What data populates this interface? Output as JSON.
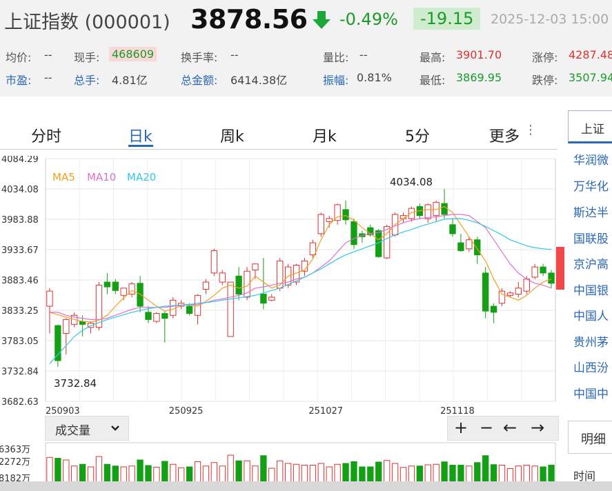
{
  "header": {
    "index_name": "上证指数 (000001)",
    "price": "3878.56",
    "change_pct": "-0.49%",
    "change": "-19.15",
    "datetime": "2025-12-03 15:00",
    "direction_icon": "down-arrow-icon"
  },
  "stats": {
    "row1": [
      {
        "label": "均价:",
        "value": "--"
      },
      {
        "label": "现手:",
        "value": "468609"
      },
      {
        "label": "换手率:",
        "value": "--"
      },
      {
        "label": "量比:",
        "value": "--"
      },
      {
        "label": "最高:",
        "value": "3901.70"
      },
      {
        "label": "涨停:",
        "value": "4287.48"
      }
    ],
    "row2": [
      {
        "label": "市盈:",
        "value": "--"
      },
      {
        "label": "总手:",
        "value": "4.81亿"
      },
      {
        "label": "总金额:",
        "value": "6414.38亿"
      },
      {
        "label": "振幅:",
        "value": "0.81%"
      },
      {
        "label": "最低:",
        "value": "3869.95"
      },
      {
        "label": "跌停:",
        "value": "3507.94"
      }
    ]
  },
  "tabs": [
    "分时",
    "日k",
    "周k",
    "月k",
    "5分",
    "更多"
  ],
  "active_tab": "日k",
  "more_icon": "vertical-dots-icon",
  "legend": {
    "ma5": "MA5",
    "ma10": "MA10",
    "ma20": "MA20"
  },
  "colors": {
    "up": "#e03030",
    "down": "#14a014",
    "ma5": "#f0a020",
    "ma10": "#e070d0",
    "ma20": "#30c8e8",
    "accent": "#2a67b5"
  },
  "annotations": {
    "high_label": "4034.08",
    "low_label": "3732.84"
  },
  "volume": {
    "selector_label": "成交量",
    "axis_labels": [
      "6363万",
      "2272万",
      "8182万"
    ],
    "toolbar": [
      "+",
      "−",
      "←",
      "→"
    ]
  },
  "sidebar": {
    "header": "上证",
    "items": [
      "华润微",
      "万华化",
      "斯达半",
      "国联股",
      "京沪高",
      "中国银",
      "中国人",
      "贵州茅",
      "山西汾",
      "中国中"
    ],
    "detail_tab": "明细",
    "time_label": "时间"
  },
  "chart_data": {
    "type": "candlestick",
    "y_ticks": [
      "4084.29",
      "4034.08",
      "3983.88",
      "3933.67",
      "3883.46",
      "3833.25",
      "3783.05",
      "3732.84",
      "3682.63"
    ],
    "ylim": [
      3682.63,
      4084.29
    ],
    "x_ticks": [
      {
        "label": "250903",
        "index": 0
      },
      {
        "label": "250925",
        "index": 15
      },
      {
        "label": "251027",
        "index": 32
      },
      {
        "label": "251118",
        "index": 48
      }
    ],
    "candles": [
      {
        "o": 3840,
        "h": 3870,
        "l": 3795,
        "c": 3865
      },
      {
        "o": 3808,
        "h": 3810,
        "l": 3740,
        "c": 3750
      },
      {
        "o": 3795,
        "h": 3820,
        "l": 3760,
        "c": 3818
      },
      {
        "o": 3810,
        "h": 3830,
        "l": 3805,
        "c": 3825
      },
      {
        "o": 3815,
        "h": 3825,
        "l": 3790,
        "c": 3810
      },
      {
        "o": 3805,
        "h": 3815,
        "l": 3795,
        "c": 3812
      },
      {
        "o": 3805,
        "h": 3880,
        "l": 3800,
        "c": 3875
      },
      {
        "o": 3880,
        "h": 3895,
        "l": 3860,
        "c": 3872
      },
      {
        "o": 3880,
        "h": 3885,
        "l": 3860,
        "c": 3866
      },
      {
        "o": 3858,
        "h": 3870,
        "l": 3850,
        "c": 3870
      },
      {
        "o": 3860,
        "h": 3880,
        "l": 3855,
        "c": 3877
      },
      {
        "o": 3878,
        "h": 3890,
        "l": 3830,
        "c": 3840
      },
      {
        "o": 3830,
        "h": 3840,
        "l": 3812,
        "c": 3818
      },
      {
        "o": 3815,
        "h": 3830,
        "l": 3812,
        "c": 3828
      },
      {
        "o": 3828,
        "h": 3832,
        "l": 3780,
        "c": 3820
      },
      {
        "o": 3825,
        "h": 3855,
        "l": 3820,
        "c": 3850
      },
      {
        "o": 3840,
        "h": 3850,
        "l": 3835,
        "c": 3845
      },
      {
        "o": 3840,
        "h": 3845,
        "l": 3825,
        "c": 3828
      },
      {
        "o": 3825,
        "h": 3860,
        "l": 3810,
        "c": 3858
      },
      {
        "o": 3868,
        "h": 3885,
        "l": 3860,
        "c": 3880
      },
      {
        "o": 3895,
        "h": 3935,
        "l": 3890,
        "c": 3932
      },
      {
        "o": 3880,
        "h": 3900,
        "l": 3875,
        "c": 3895
      },
      {
        "o": 3790,
        "h": 3880,
        "l": 3790,
        "c": 3880
      },
      {
        "o": 3890,
        "h": 3905,
        "l": 3850,
        "c": 3860
      },
      {
        "o": 3855,
        "h": 3905,
        "l": 3850,
        "c": 3898
      },
      {
        "o": 3900,
        "h": 3910,
        "l": 3885,
        "c": 3910
      },
      {
        "o": 3860,
        "h": 3920,
        "l": 3835,
        "c": 3845
      },
      {
        "o": 3850,
        "h": 3860,
        "l": 3848,
        "c": 3855
      },
      {
        "o": 3870,
        "h": 3920,
        "l": 3865,
        "c": 3915
      },
      {
        "o": 3875,
        "h": 3910,
        "l": 3870,
        "c": 3905
      },
      {
        "o": 3880,
        "h": 3910,
        "l": 3875,
        "c": 3908
      },
      {
        "o": 3898,
        "h": 3920,
        "l": 3890,
        "c": 3915
      },
      {
        "o": 3925,
        "h": 3950,
        "l": 3920,
        "c": 3945
      },
      {
        "o": 3960,
        "h": 3995,
        "l": 3955,
        "c": 3992
      },
      {
        "o": 3980,
        "h": 3990,
        "l": 3970,
        "c": 3985
      },
      {
        "o": 3982,
        "h": 4010,
        "l": 3975,
        "c": 4008
      },
      {
        "o": 4000,
        "h": 4015,
        "l": 3975,
        "c": 3983
      },
      {
        "o": 3980,
        "h": 3985,
        "l": 3935,
        "c": 3942
      },
      {
        "o": 3960,
        "h": 3965,
        "l": 3945,
        "c": 3955
      },
      {
        "o": 3970,
        "h": 3975,
        "l": 3955,
        "c": 3958
      },
      {
        "o": 3965,
        "h": 3968,
        "l": 3920,
        "c": 3922
      },
      {
        "o": 3920,
        "h": 3975,
        "l": 3918,
        "c": 3972
      },
      {
        "o": 3958,
        "h": 3995,
        "l": 3955,
        "c": 3992
      },
      {
        "o": 3985,
        "h": 3995,
        "l": 3978,
        "c": 3990
      },
      {
        "o": 3985,
        "h": 4005,
        "l": 3980,
        "c": 4002
      },
      {
        "o": 4005,
        "h": 4010,
        "l": 3985,
        "c": 3990
      },
      {
        "o": 3985,
        "h": 4010,
        "l": 3978,
        "c": 4008
      },
      {
        "o": 3990,
        "h": 4015,
        "l": 3980,
        "c": 4012
      },
      {
        "o": 4010,
        "h": 4034,
        "l": 3985,
        "c": 3992
      },
      {
        "o": 3975,
        "h": 3985,
        "l": 3955,
        "c": 3960
      },
      {
        "o": 3945,
        "h": 3960,
        "l": 3930,
        "c": 3932
      },
      {
        "o": 3935,
        "h": 3955,
        "l": 3930,
        "c": 3950
      },
      {
        "o": 3950,
        "h": 3955,
        "l": 3910,
        "c": 3925
      },
      {
        "o": 3895,
        "h": 3905,
        "l": 3820,
        "c": 3832
      },
      {
        "o": 3840,
        "h": 3845,
        "l": 3812,
        "c": 3830
      },
      {
        "o": 3845,
        "h": 3870,
        "l": 3840,
        "c": 3865
      },
      {
        "o": 3858,
        "h": 3865,
        "l": 3855,
        "c": 3862
      },
      {
        "o": 3860,
        "h": 3880,
        "l": 3855,
        "c": 3870
      },
      {
        "o": 3865,
        "h": 3890,
        "l": 3860,
        "c": 3885
      },
      {
        "o": 3888,
        "h": 3910,
        "l": 3885,
        "c": 3905
      },
      {
        "o": 3905,
        "h": 3910,
        "l": 3890,
        "c": 3895
      },
      {
        "o": 3895,
        "h": 3900,
        "l": 3870,
        "c": 3878
      }
    ],
    "ma5": [
      3830,
      3826,
      3822,
      3818,
      3815,
      3814,
      3817,
      3825,
      3840,
      3854,
      3866,
      3860,
      3850,
      3840,
      3832,
      3835,
      3842,
      3843,
      3840,
      3848,
      3858,
      3870,
      3875,
      3870,
      3873,
      3890,
      3880,
      3870,
      3875,
      3890,
      3895,
      3900,
      3918,
      3950,
      3975,
      3988,
      3990,
      3982,
      3970,
      3960,
      3950,
      3960,
      3975,
      3985,
      3995,
      3998,
      4000,
      4000,
      4005,
      3995,
      3975,
      3955,
      3935,
      3915,
      3885,
      3860,
      3855,
      3850,
      3858,
      3870,
      3880,
      3885
    ],
    "ma10": [
      3830,
      3830,
      3825,
      3822,
      3820,
      3818,
      3818,
      3820,
      3825,
      3830,
      3835,
      3838,
      3838,
      3838,
      3838,
      3840,
      3842,
      3842,
      3843,
      3846,
      3850,
      3852,
      3855,
      3858,
      3862,
      3870,
      3872,
      3875,
      3878,
      3880,
      3885,
      3888,
      3895,
      3905,
      3915,
      3930,
      3945,
      3952,
      3957,
      3960,
      3962,
      3967,
      3973,
      3978,
      3982,
      3985,
      3987,
      3988,
      3990,
      3992,
      3992,
      3990,
      3980,
      3970,
      3950,
      3930,
      3910,
      3895,
      3885,
      3878,
      3875,
      3870
    ],
    "ma20": [
      3745,
      3760,
      3775,
      3790,
      3800,
      3808,
      3813,
      3818,
      3822,
      3826,
      3830,
      3833,
      3836,
      3838,
      3840,
      3841,
      3842,
      3843,
      3845,
      3846,
      3848,
      3850,
      3852,
      3854,
      3856,
      3858,
      3862,
      3866,
      3870,
      3876,
      3882,
      3888,
      3895,
      3902,
      3910,
      3918,
      3925,
      3930,
      3935,
      3940,
      3945,
      3952,
      3958,
      3963,
      3967,
      3972,
      3976,
      3980,
      3984,
      3985,
      3985,
      3982,
      3978,
      3972,
      3965,
      3958,
      3950,
      3945,
      3940,
      3937,
      3935,
      3934
    ]
  }
}
